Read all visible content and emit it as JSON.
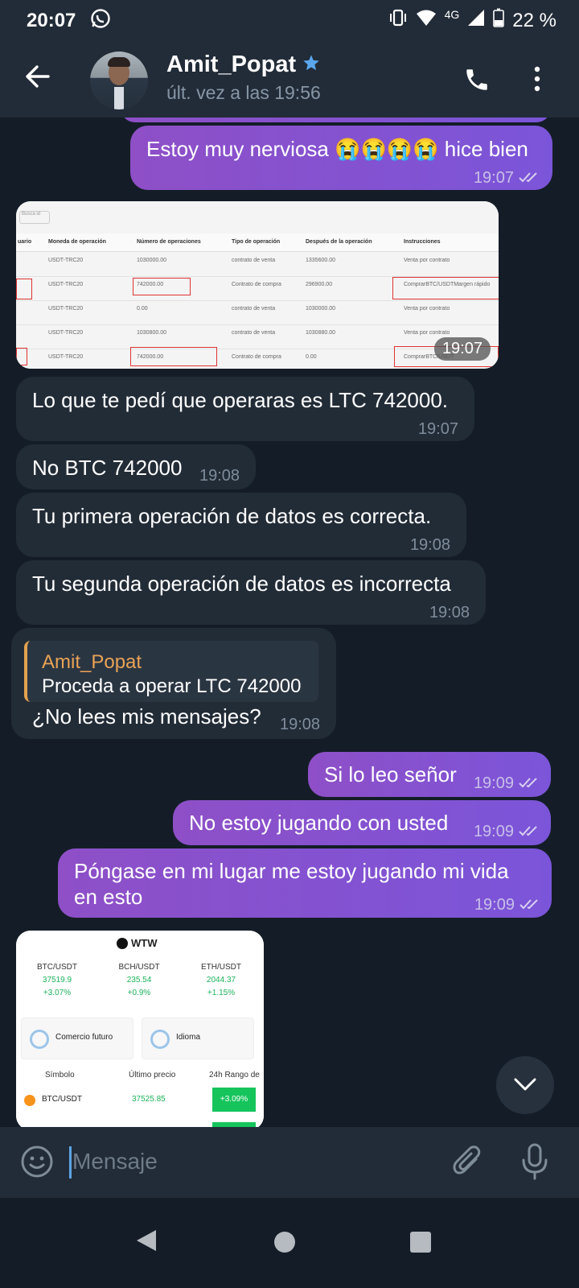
{
  "status_bar": {
    "time": "20:07",
    "network": "4G",
    "battery": "22 %"
  },
  "header": {
    "contact_name": "Amit_Popat",
    "last_seen": "últ. vez a las 19:56"
  },
  "messages": [
    {
      "text": "Estoy muy nerviosa 😭😭😭😭 hice bien",
      "time": "19:07"
    },
    {
      "image_time": "19:07",
      "table": {
        "search_placeholder": "Busca id",
        "headers": [
          "uario",
          "Moneda de operación",
          "Número de operaciones",
          "Tipo de operación",
          "Después de la operación",
          "Instrucciones"
        ],
        "rows": [
          [
            "USDT-TRC20",
            "1030000.00",
            "contrato de venta",
            "1335600.00",
            "Venta por contrato"
          ],
          [
            "USDT-TRC20",
            "742000.00",
            "Contrato de compra",
            "296900.00",
            "ComprarBTC/USDTMargen rápido"
          ],
          [
            "USDT-TRC20",
            "0.00",
            "contrato de venta",
            "1030000.00",
            "Venta por contrato"
          ],
          [
            "USDT-TRC20",
            "1030800.00",
            "contrato de venta",
            "1030880.00",
            "Venta por contrato"
          ],
          [
            "USDT-TRC20",
            "742000.00",
            "Contrato de compra",
            "0.00",
            "ComprarBTC/USDT"
          ]
        ]
      }
    },
    {
      "text": "Lo que te pedí que operaras es LTC 742000.",
      "time": "19:07"
    },
    {
      "text": "No BTC 742000",
      "time": "19:08"
    },
    {
      "text": "Tu primera operación de datos es correcta.",
      "time": "19:08"
    },
    {
      "text": "Tu segunda operación de datos es incorrecta",
      "time": "19:08"
    },
    {
      "quote_name": "Amit_Popat",
      "quote_text": "Proceda a operar LTC 742000",
      "text": "¿No lees mis mensajes?",
      "time": "19:08"
    },
    {
      "text": "Si lo leo señor",
      "time": "19:09"
    },
    {
      "text": "No estoy jugando con usted",
      "time": "19:09"
    },
    {
      "text_line1": "Póngase en mi lugar me estoy jugando mi vida",
      "text_line2": "en esto",
      "time": "19:09"
    },
    {
      "app": {
        "logo": "WTW",
        "pairs": [
          {
            "pair": "BTC/USDT",
            "price": "37519.9",
            "change": "+3.07%"
          },
          {
            "pair": "BCH/USDT",
            "price": "235.54",
            "change": "+0.9%"
          },
          {
            "pair": "ETH/USDT",
            "price": "2044.37",
            "change": "+1.15%"
          }
        ],
        "card1": "Comercio futuro",
        "card2": "Idioma",
        "col1": "Símbolo",
        "col2": "Último precio",
        "col3": "24h Rango de",
        "row_symbol": "BTC/USDT",
        "row_price": "37525.85",
        "row_change": "+3.09%"
      }
    }
  ],
  "input": {
    "placeholder": "Mensaje"
  },
  "colors": {
    "outgoing": "#7b55d9",
    "incoming": "#222c37",
    "background": "#141d27",
    "header": "#222c38",
    "quote_accent": "#e2a24e"
  }
}
